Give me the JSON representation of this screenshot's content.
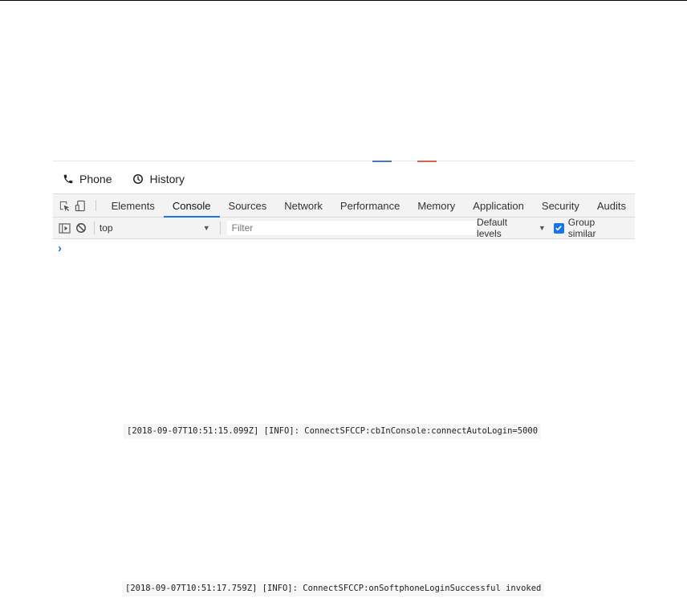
{
  "softphone": {
    "tabs": [
      {
        "label": "Phone",
        "icon": "phone-icon"
      },
      {
        "label": "History",
        "icon": "clock-icon"
      }
    ]
  },
  "devtools": {
    "tabs": [
      {
        "label": "Elements",
        "active": false
      },
      {
        "label": "Console",
        "active": true
      },
      {
        "label": "Sources",
        "active": false
      },
      {
        "label": "Network",
        "active": false
      },
      {
        "label": "Performance",
        "active": false
      },
      {
        "label": "Memory",
        "active": false
      },
      {
        "label": "Application",
        "active": false
      },
      {
        "label": "Security",
        "active": false
      },
      {
        "label": "Audits",
        "active": false
      }
    ],
    "toolbar": {
      "context": "top",
      "filter_placeholder": "Filter",
      "levels": "Default levels",
      "group_similar": "Group similar",
      "group_similar_checked": true
    },
    "prompt": "›"
  },
  "logs": [
    "[2018-09-07T10:51:15.099Z] [INFO]: ConnectSFCCP:cbInConsole:connectAutoLogin=5000",
    "[2018-09-07T10:51:17.759Z] [INFO]: ConnectSFCCP:onSoftphoneLoginSuccessful invoked"
  ],
  "colors": {
    "accent": "#1a73e8",
    "toolbar_bg": "#f3f3f3",
    "border": "#dadada"
  }
}
